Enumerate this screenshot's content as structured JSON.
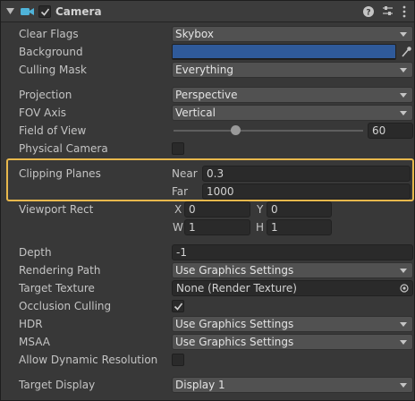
{
  "header": {
    "title": "Camera",
    "enabled": true
  },
  "rows": {
    "clear_flags": {
      "label": "Clear Flags",
      "value": "Skybox"
    },
    "background": {
      "label": "Background",
      "color": "#2f5a9a"
    },
    "culling_mask": {
      "label": "Culling Mask",
      "value": "Everything"
    },
    "projection": {
      "label": "Projection",
      "value": "Perspective"
    },
    "fov_axis": {
      "label": "FOV Axis",
      "value": "Vertical"
    },
    "field_of_view": {
      "label": "Field of View",
      "value": "60",
      "slider_fraction": 0.33
    },
    "physical_camera": {
      "label": "Physical Camera",
      "checked": false
    },
    "clipping_planes": {
      "label": "Clipping Planes",
      "near_label": "Near",
      "near_value": "0.3",
      "far_label": "Far",
      "far_value": "1000"
    },
    "viewport_rect": {
      "label": "Viewport Rect",
      "x_label": "X",
      "x_value": "0",
      "y_label": "Y",
      "y_value": "0",
      "w_label": "W",
      "w_value": "1",
      "h_label": "H",
      "h_value": "1"
    },
    "depth": {
      "label": "Depth",
      "value": "-1"
    },
    "rendering_path": {
      "label": "Rendering Path",
      "value": "Use Graphics Settings"
    },
    "target_texture": {
      "label": "Target Texture",
      "value": "None (Render Texture)"
    },
    "occlusion_culling": {
      "label": "Occlusion Culling",
      "checked": true
    },
    "hdr": {
      "label": "HDR",
      "value": "Use Graphics Settings"
    },
    "msaa": {
      "label": "MSAA",
      "value": "Use Graphics Settings"
    },
    "allow_dynamic_resolution": {
      "label": "Allow Dynamic Resolution",
      "checked": false
    },
    "target_display": {
      "label": "Target Display",
      "value": "Display 1"
    }
  },
  "colors": {
    "highlight": "#e8b84c",
    "camera_icon": "#4fb3d9"
  }
}
